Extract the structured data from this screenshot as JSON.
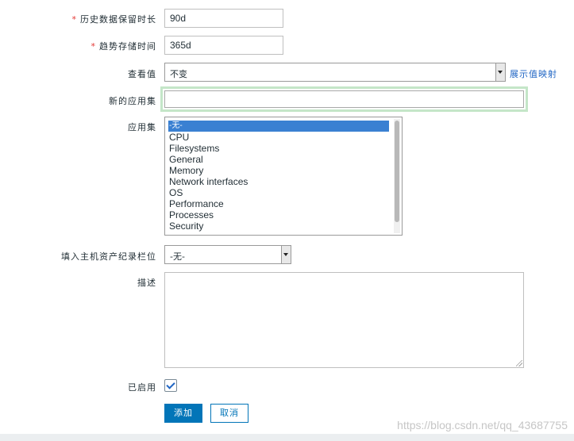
{
  "form": {
    "history_label": "历史数据保留时长",
    "history_required": "*",
    "history_value": "90d",
    "trends_label": "趋势存储时间",
    "trends_required": "*",
    "trends_value": "365d",
    "valuemap_label": "查看值",
    "valuemap_selected": "不变",
    "valuemap_link": "展示值映射",
    "new_app_label": "新的应用集",
    "new_app_value": "",
    "apps_label": "应用集",
    "apps_options": [
      "-无-",
      "CPU",
      "Filesystems",
      "General",
      "Memory",
      "Network interfaces",
      "OS",
      "Performance",
      "Processes",
      "Security"
    ],
    "inventory_label": "填入主机资产纪录栏位",
    "inventory_selected": "-无-",
    "description_label": "描述",
    "description_value": "",
    "enabled_label": "已启用",
    "enabled_checked": true
  },
  "buttons": {
    "add": "添加",
    "cancel": "取消"
  },
  "watermark": "https://blog.csdn.net/qq_43687755",
  "colors": {
    "accent": "#0275b8",
    "selected_option": "#3a80d2",
    "required_star": "#e33734",
    "focus_border": "#c4e6c8"
  }
}
